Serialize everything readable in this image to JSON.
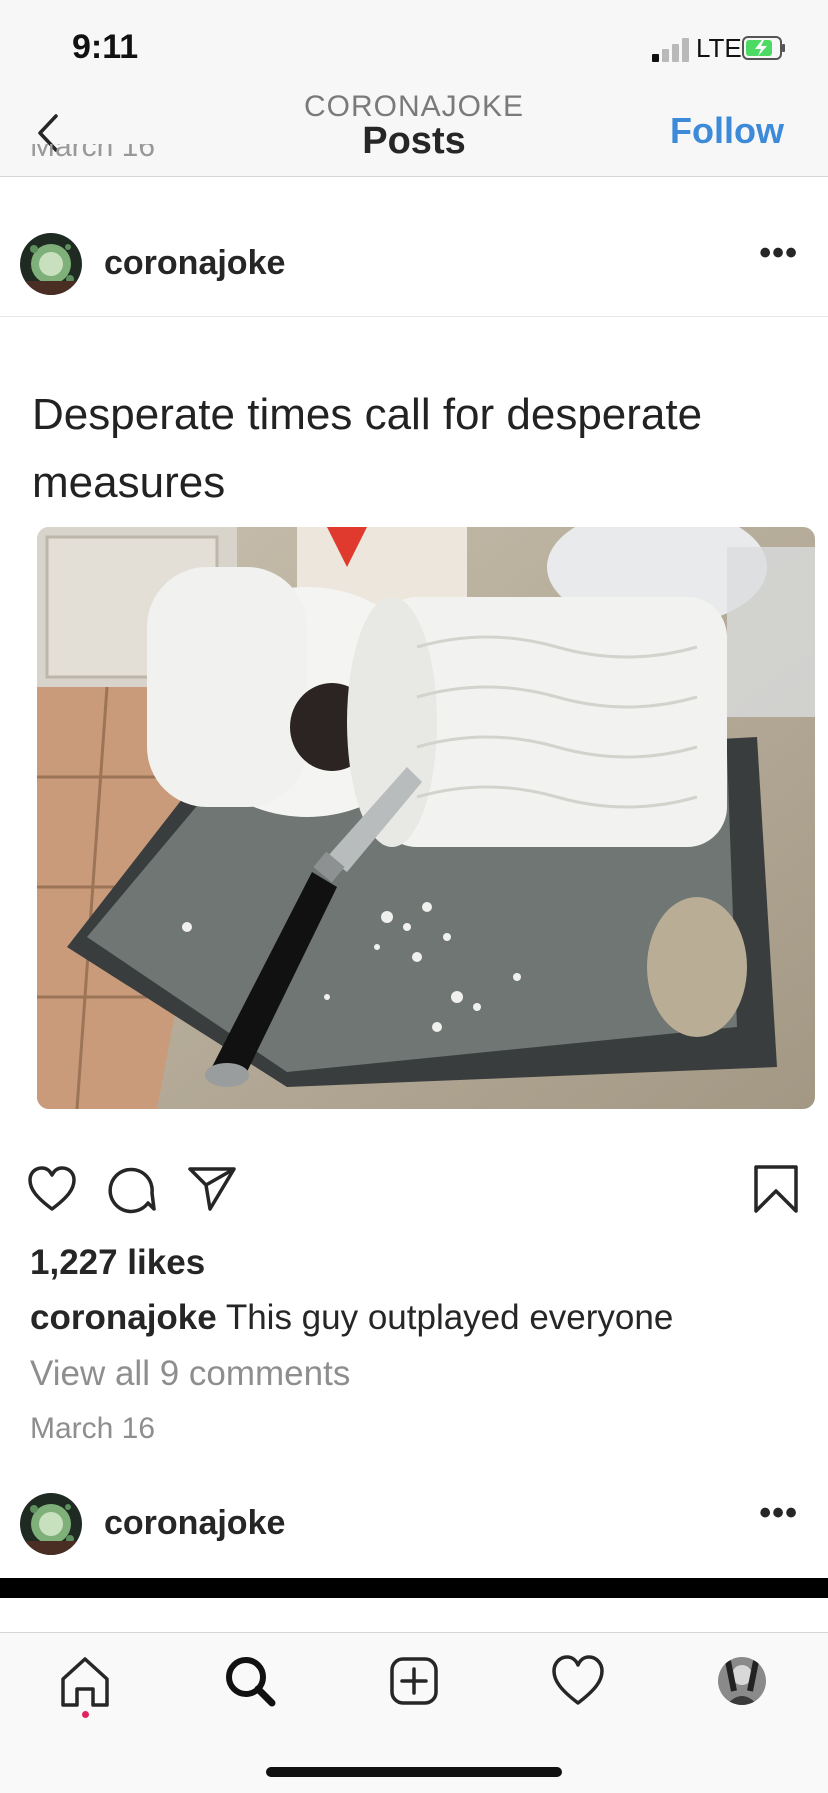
{
  "status": {
    "time": "9:11",
    "network": "LTE"
  },
  "header": {
    "account": "CORONAJOKE",
    "title": "Posts",
    "follow_label": "Follow"
  },
  "previous_post": {
    "date_fragment": "March 16"
  },
  "post": {
    "username": "coronajoke",
    "more_label": "•••",
    "image_caption": "Desperate times call for desperate measures",
    "likes": "1,227 likes",
    "caption_user": "coronajoke",
    "caption_text": " This guy outplayed everyone",
    "view_comments": "View all 9 comments",
    "date": "March 16"
  },
  "next_post": {
    "username": "coronajoke",
    "more_label": "•••"
  },
  "tab_bar": {
    "items": [
      "home-icon",
      "search-icon",
      "new-post-icon",
      "activity-heart-icon",
      "profile-avatar"
    ],
    "notification_color": "#e0245e"
  },
  "colors": {
    "accent": "#3d8bd8",
    "muted": "#8e8e8e",
    "text": "#262626"
  }
}
